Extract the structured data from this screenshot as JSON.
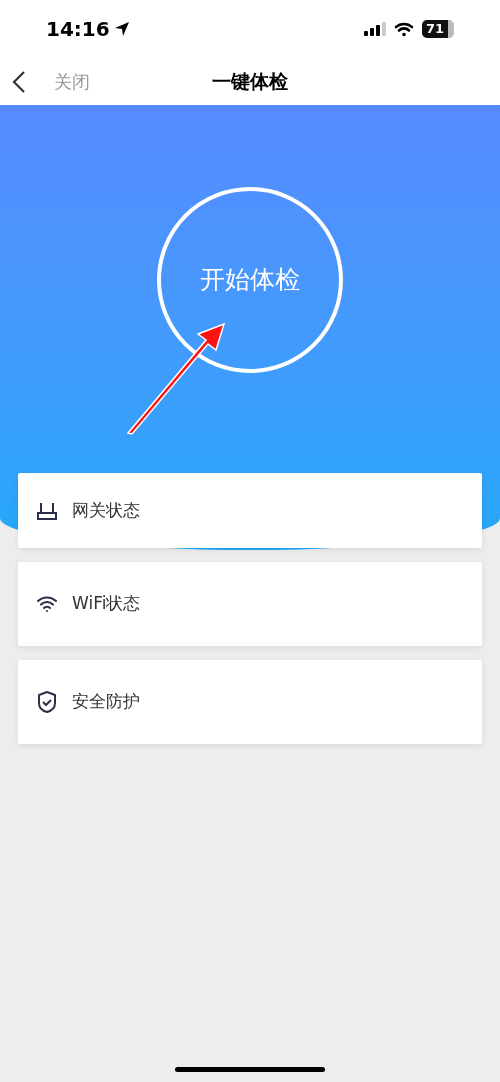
{
  "status_bar": {
    "time": "14:16",
    "battery": "71"
  },
  "nav": {
    "back_label": "关闭",
    "title": "一键体检"
  },
  "check_button": {
    "label": "开始体检"
  },
  "items": [
    {
      "kind": "gateway",
      "label": "网关状态"
    },
    {
      "kind": "wifi",
      "label": "WiFi状态"
    },
    {
      "kind": "shield",
      "label": "安全防护"
    }
  ]
}
